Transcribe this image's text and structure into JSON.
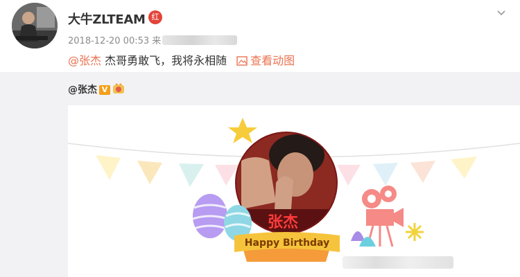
{
  "post": {
    "user_name": "大牛ZLTEAM",
    "badge_text": "红",
    "timestamp": "2018-12-20 00:53",
    "source_prefix": "来",
    "mention": "@张杰",
    "text": " 杰哥勇敢飞，我将永相随",
    "view_gif": "查看动图",
    "accent_color": "#eb7350"
  },
  "repost": {
    "author": "@张杰",
    "v_badge": "V",
    "crown_icon": "crown-badge-icon"
  },
  "image": {
    "banner_text": "Happy Birthday",
    "poster_name": "张杰"
  }
}
